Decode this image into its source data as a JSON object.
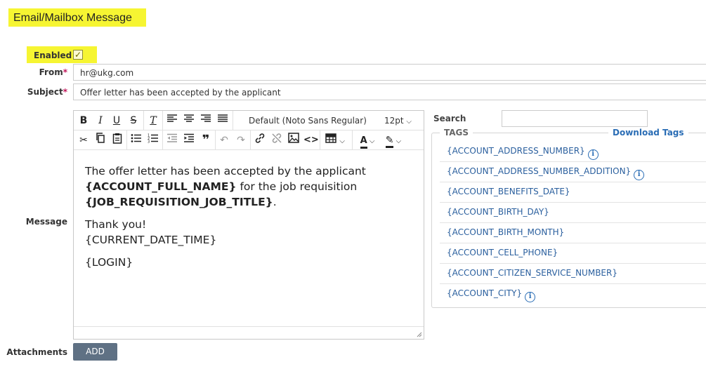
{
  "page_title": "Email/Mailbox Message",
  "enabled": {
    "label": "Enabled",
    "checked": true,
    "check_glyph": "✓"
  },
  "from": {
    "label": "From",
    "required_mark": "*",
    "value": "hr@ukg.com"
  },
  "subject": {
    "label": "Subject",
    "required_mark": "*",
    "value": "Offer letter has been accepted by the applicant"
  },
  "message": {
    "label": "Message"
  },
  "editor": {
    "toolbar": {
      "font_family": "Default (Noto Sans Regular)",
      "font_size": "12pt",
      "icons": [
        "bold-icon",
        "italic-icon",
        "underline-icon",
        "strikethrough-icon",
        "clear-format-icon",
        "align-left-icon",
        "align-center-icon",
        "align-right-icon",
        "align-justify-icon",
        "cut-icon",
        "copy-icon",
        "paste-icon",
        "bullet-list-icon",
        "numbered-list-icon",
        "outdent-icon",
        "indent-icon",
        "blockquote-icon",
        "undo-icon",
        "redo-icon",
        "link-icon",
        "unlink-icon",
        "image-icon",
        "code-icon",
        "table-icon",
        "text-color-icon",
        "highlight-icon"
      ]
    },
    "content": {
      "line1_text": "The offer letter has been accepted by the applicant",
      "tag_full_name": "{ACCOUNT_FULL_NAME}",
      "line2_mid": " for the job requisition",
      "tag_job_title": "{JOB_REQUISITION_JOB_TITLE}",
      "line3_end": ".",
      "thanks": "Thank you!",
      "date_tag": "{CURRENT_DATE_TIME}",
      "login_tag": "{LOGIN}"
    }
  },
  "search": {
    "label": "Search",
    "value": ""
  },
  "tags": {
    "legend": "TAGS",
    "download_label": "Download Tags",
    "items": [
      {
        "label": "{ACCOUNT_ADDRESS_NUMBER}",
        "info": true
      },
      {
        "label": "{ACCOUNT_ADDRESS_NUMBER_ADDITION}",
        "info": true
      },
      {
        "label": "{ACCOUNT_BENEFITS_DATE}",
        "info": false
      },
      {
        "label": "{ACCOUNT_BIRTH_DAY}",
        "info": false
      },
      {
        "label": "{ACCOUNT_BIRTH_MONTH}",
        "info": false
      },
      {
        "label": "{ACCOUNT_CELL_PHONE}",
        "info": false
      },
      {
        "label": "{ACCOUNT_CITIZEN_SERVICE_NUMBER}",
        "info": false
      },
      {
        "label": "{ACCOUNT_CITY}",
        "info": true
      }
    ],
    "info_glyph": "i"
  },
  "attachments": {
    "label": "Attachments",
    "add_label": "ADD"
  },
  "colors": {
    "highlight": "#f6f532",
    "link": "#2a5f9e",
    "button": "#5f7184"
  }
}
